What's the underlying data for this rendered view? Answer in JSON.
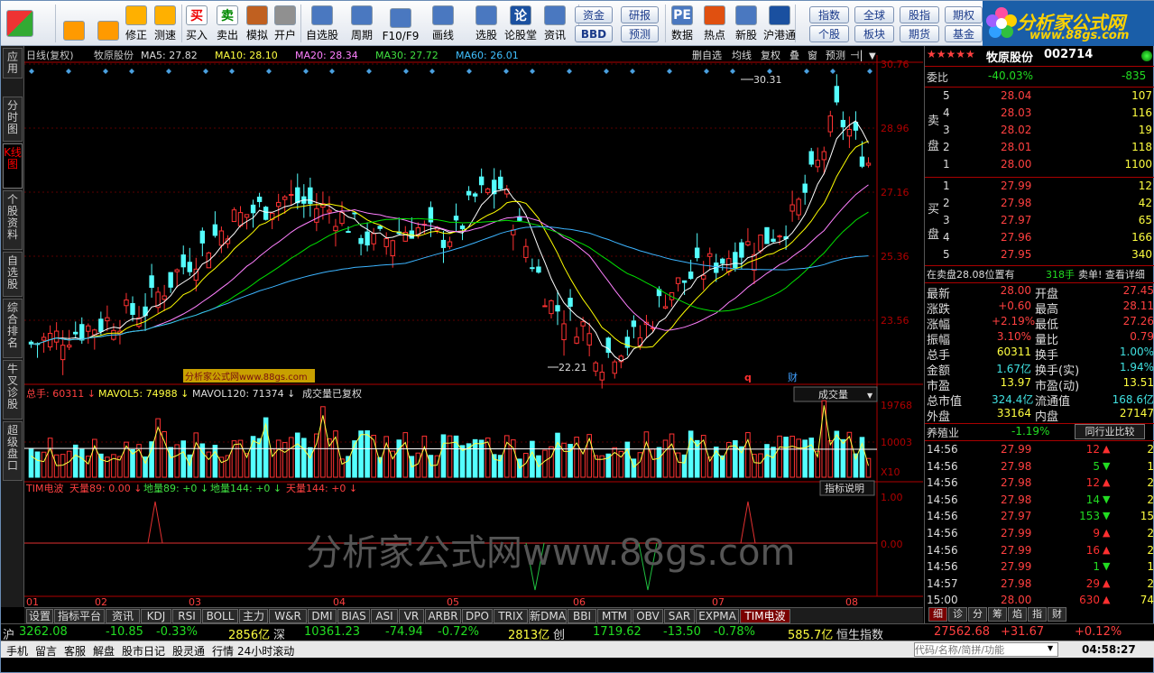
{
  "toolbar": {
    "buttons": [
      {
        "label": "",
        "icon": "windows-logo-icon"
      },
      {
        "label": "",
        "icon": "back-arrow-icon"
      },
      {
        "label": "",
        "icon": "up-down-arrow-icon"
      },
      {
        "label": "修正",
        "icon": "sun-icon"
      },
      {
        "label": "测速",
        "icon": "clock-icon"
      },
      {
        "label": "买入",
        "icon": "buy-icon",
        "glyph": "买"
      },
      {
        "label": "卖出",
        "icon": "sell-icon",
        "glyph": "卖"
      },
      {
        "label": "模拟",
        "icon": "hammer-icon"
      },
      {
        "label": "开户",
        "icon": "lock-icon"
      },
      {
        "label": "自选股",
        "icon": "star-icon"
      },
      {
        "label": "周期",
        "icon": "clock-cycle-icon"
      },
      {
        "label": "F10/F9",
        "icon": "chart-doc-icon"
      },
      {
        "label": "画线",
        "icon": "pencil-icon"
      },
      {
        "label": "选股",
        "icon": "monitor-icon"
      },
      {
        "label": "论股堂",
        "icon": "forum-icon",
        "glyph": "论"
      },
      {
        "label": "资讯",
        "icon": "info-icon"
      },
      {
        "label": "数据",
        "icon": "pe-icon",
        "glyph": "PE"
      },
      {
        "label": "热点",
        "icon": "fire-icon"
      },
      {
        "label": "新股",
        "icon": "new-stock-icon"
      },
      {
        "label": "沪港通",
        "icon": "hk-icon"
      }
    ],
    "small_buttons": [
      "资金",
      "研报",
      "BBD",
      "预测",
      "指数",
      "全球",
      "股指",
      "期权",
      "个股",
      "板块",
      "期货",
      "基金"
    ]
  },
  "logo": {
    "title": "分析家公式网",
    "url": "www.88gs.com"
  },
  "left_tabs": [
    {
      "label": "应用"
    },
    {
      "label": "分时图"
    },
    {
      "label": "K线图",
      "active": true
    },
    {
      "label": "个股资料"
    },
    {
      "label": "自选股"
    },
    {
      "label": "综合排名"
    },
    {
      "label": "牛叉诊股"
    },
    {
      "label": "超级盘口"
    }
  ],
  "kline": {
    "header": {
      "period": "日线(复权)",
      "name": "牧原股份",
      "ma5": "MA5: 27.82",
      "ma10": "MA10: 28.10",
      "ma20": "MA20: 28.34",
      "ma30": "MA30: 27.72",
      "ma60": "MA60: 26.01"
    },
    "header_buttons": [
      "删自选",
      "均线",
      "复权",
      "叠",
      "窗",
      "预测"
    ],
    "price_axis": [
      "30.76",
      "28.96",
      "27.16",
      "25.36",
      "23.56"
    ],
    "high_label": "30.31",
    "low_label": "22.21",
    "watermark_small": "分析家公式网www.88gs.com",
    "marker_q": "q",
    "marker_cai": "财",
    "colors": {
      "up": "#ff3232",
      "down": "#54ffff",
      "ma5": "#ffffff",
      "ma10": "#ffff00",
      "ma20": "#ff80ff",
      "ma30": "#00e000",
      "ma60": "#3cb4ff",
      "axis": "#b00000"
    }
  },
  "volume": {
    "header": {
      "total": "总手: 60311",
      "mavol5": "MAVOL5: 74988",
      "mavol120": "MAVOL120: 71374",
      "note": "成交量已复权"
    },
    "dropdown": "成交量",
    "axis": [
      "19768",
      "10003",
      "X10"
    ]
  },
  "indicator": {
    "header": {
      "name": "TIM电波",
      "tian89": "天量89: 0.00",
      "di89": "地量89: +0",
      "di144": "地量144: +0",
      "tian144": "天量144: +0"
    },
    "button": "指标说明",
    "axis": [
      "1.00",
      "0.00"
    ],
    "watermark": "分析家公式网www.88gs.com"
  },
  "x_axis": [
    "01",
    "02",
    "03",
    "04",
    "05",
    "06",
    "07",
    "08"
  ],
  "bottom_tabs": [
    "设置",
    "指标平台",
    "资讯",
    "KDJ",
    "RSI",
    "BOLL",
    "主力",
    "W&R",
    "DMI",
    "BIAS",
    "ASI",
    "VR",
    "ARBR",
    "DPO",
    "TRIX",
    "新DMA",
    "BBI",
    "MTM",
    "OBV",
    "SAR",
    "EXPMA",
    "TIM电波"
  ],
  "quote": {
    "stars": "★★★★★",
    "name": "牧原股份",
    "code": "002714",
    "weibi_label": "委比",
    "weibi": "-40.03%",
    "weicha": "-835",
    "sell_label": "卖盘",
    "buy_label": "买盘",
    "sell": [
      {
        "lvl": "5",
        "price": "28.04",
        "vol": "107"
      },
      {
        "lvl": "4",
        "price": "28.03",
        "vol": "116"
      },
      {
        "lvl": "3",
        "price": "28.02",
        "vol": "19"
      },
      {
        "lvl": "2",
        "price": "28.01",
        "vol": "118"
      },
      {
        "lvl": "1",
        "price": "28.00",
        "vol": "1100"
      }
    ],
    "buy": [
      {
        "lvl": "1",
        "price": "27.99",
        "vol": "12"
      },
      {
        "lvl": "2",
        "price": "27.98",
        "vol": "42"
      },
      {
        "lvl": "3",
        "price": "27.97",
        "vol": "65"
      },
      {
        "lvl": "4",
        "price": "27.96",
        "vol": "166"
      },
      {
        "lvl": "5",
        "price": "27.95",
        "vol": "340"
      }
    ],
    "msg_left": "在卖盘28.08位置有",
    "msg_vol": "318手",
    "msg_right": "卖单! 查看详细",
    "stats": [
      [
        "最新",
        "28.00",
        "开盘",
        "27.45"
      ],
      [
        "涨跌",
        "+0.60",
        "最高",
        "28.11"
      ],
      [
        "涨幅",
        "+2.19%",
        "最低",
        "27.26"
      ],
      [
        "振幅",
        "3.10%",
        "量比",
        "0.79"
      ],
      [
        "总手",
        "60311",
        "换手",
        "1.00%"
      ],
      [
        "金额",
        "1.67亿",
        "换手(实)",
        "1.94%"
      ],
      [
        "市盈",
        "13.97",
        "市盈(动)",
        "13.51"
      ],
      [
        "总市值",
        "324.4亿",
        "流通值",
        "168.6亿"
      ],
      [
        "外盘",
        "33164",
        "内盘",
        "27147"
      ]
    ],
    "industry": "养殖业",
    "industry_pct": "-1.19%",
    "industry_btn": "同行业比较",
    "ticks": [
      {
        "t": "14:56",
        "p": "27.99",
        "v": "12",
        "d": "up",
        "n": "2"
      },
      {
        "t": "14:56",
        "p": "27.98",
        "v": "5",
        "d": "down",
        "n": "1"
      },
      {
        "t": "14:56",
        "p": "27.98",
        "v": "12",
        "d": "up",
        "n": "2"
      },
      {
        "t": "14:56",
        "p": "27.98",
        "v": "14",
        "d": "down",
        "n": "2"
      },
      {
        "t": "14:56",
        "p": "27.97",
        "v": "153",
        "d": "down",
        "n": "15"
      },
      {
        "t": "14:56",
        "p": "27.99",
        "v": "9",
        "d": "up",
        "n": "2"
      },
      {
        "t": "14:56",
        "p": "27.99",
        "v": "16",
        "d": "up",
        "n": "2"
      },
      {
        "t": "14:56",
        "p": "27.99",
        "v": "1",
        "d": "down",
        "n": "1"
      },
      {
        "t": "14:57",
        "p": "27.98",
        "v": "29",
        "d": "up",
        "n": "2"
      },
      {
        "t": "15:00",
        "p": "28.00",
        "v": "630",
        "d": "up",
        "n": "74"
      }
    ],
    "tabs": [
      "细",
      "诊",
      "分",
      "筹",
      "焰",
      "指",
      "财"
    ]
  },
  "status": {
    "sh_label": "沪",
    "sh_idx": "3262.08",
    "sh_chg": "-10.85",
    "sh_pct": "-0.33%",
    "sh_amt": "2856亿",
    "sz_label": "深",
    "sz_idx": "10361.23",
    "sz_chg": "-74.94",
    "sz_pct": "-0.72%",
    "sz_amt": "2813亿",
    "cy_label": "创",
    "cy_idx": "1719.62",
    "cy_chg": "-13.50",
    "cy_pct": "-0.78%",
    "cy_amt": "585.7亿",
    "hs_label": "恒生指数",
    "hs_idx": "27562.68",
    "hs_chg": "+31.67",
    "hs_pct": "+0.12%"
  },
  "statusbar": {
    "items": [
      "手机",
      "留言",
      "客服",
      "解盘",
      "股市日记",
      "股灵通",
      "行情",
      "24小时滚动"
    ],
    "search_placeholder": "代码/名称/简拼/功能",
    "time": "04:58:27"
  }
}
